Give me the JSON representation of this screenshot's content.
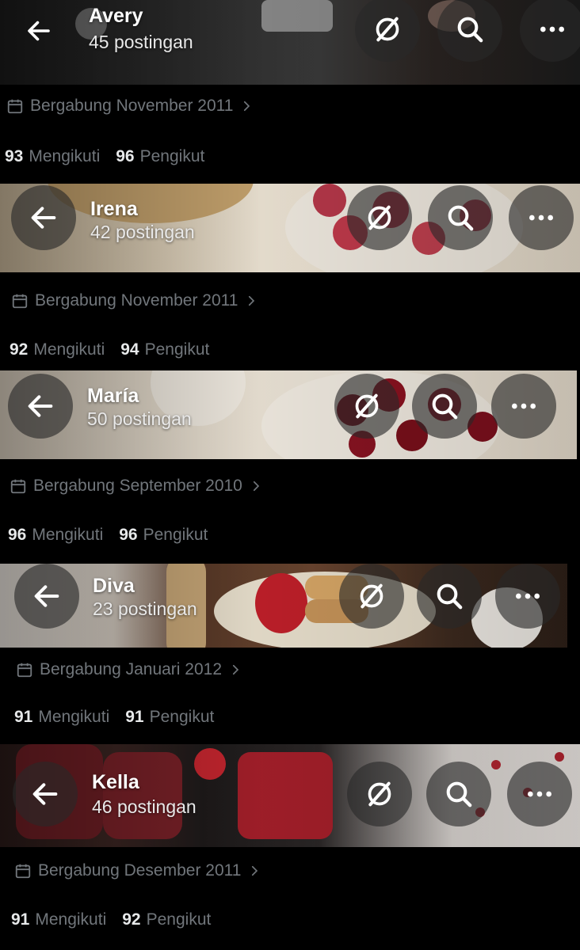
{
  "colors": {
    "background": "#000000",
    "primary_text": "#e7e9ea",
    "secondary_text": "#71767b",
    "circle_button": "rgba(40,40,40,0.62)"
  },
  "icons": {
    "back": "arrow-left-icon",
    "grok": "slashed-circle-icon",
    "search": "search-icon",
    "more": "more-dots-icon",
    "calendar": "calendar-icon",
    "chevron": "chevron-right-icon"
  },
  "profiles": [
    {
      "name": "Avery",
      "posts": "45 postingan",
      "joined": "Bergabung November 2011",
      "following_count": "93",
      "following_label": "Mengikuti",
      "followers_count": "96",
      "followers_label": "Pengikut"
    },
    {
      "name": "Irena",
      "posts": "42 postingan",
      "joined": "Bergabung November 2011",
      "following_count": "92",
      "following_label": "Mengikuti",
      "followers_count": "94",
      "followers_label": "Pengikut"
    },
    {
      "name": "María",
      "posts": "50 postingan",
      "joined": "Bergabung September 2010",
      "following_count": "96",
      "following_label": "Mengikuti",
      "followers_count": "96",
      "followers_label": "Pengikut"
    },
    {
      "name": "Diva",
      "posts": "23 postingan",
      "joined": "Bergabung Januari 2012",
      "following_count": "91",
      "following_label": "Mengikuti",
      "followers_count": "91",
      "followers_label": "Pengikut"
    },
    {
      "name": "Kella",
      "posts": "46 postingan",
      "joined": "Bergabung Desember 2011",
      "following_count": "91",
      "following_label": "Mengikuti",
      "followers_count": "92",
      "followers_label": "Pengikut"
    }
  ]
}
